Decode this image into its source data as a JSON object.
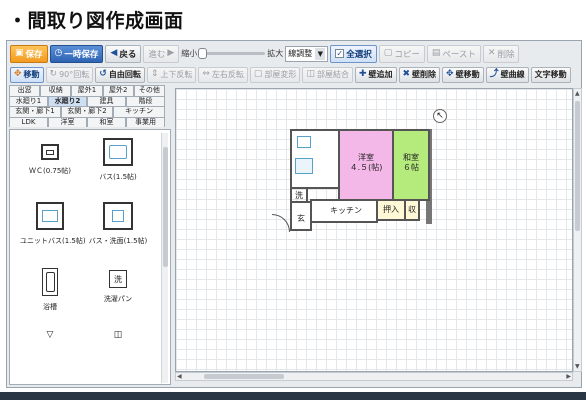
{
  "page": {
    "heading": "・間取り図作成画面"
  },
  "toolbar_main": {
    "save": "保存",
    "temp_save": "一時保存",
    "undo": "戻る",
    "redo": "進む",
    "zoom_small": "縮小",
    "zoom_large": "拡大",
    "wall_adjust": "線調整",
    "select_all": "全選択",
    "copy": "コピー",
    "paste": "ペースト",
    "delete": "削除"
  },
  "toolbar_edit": {
    "move": "移動",
    "rotate90": "90°回転",
    "free_rotate": "自由回転",
    "flip_v": "上下反転",
    "flip_h": "左右反転",
    "room_deform": "部屋変形",
    "room_join": "部屋結合",
    "add_wall": "壁追加",
    "delete_wall": "壁削除",
    "move_wall": "壁移動",
    "curve_wall": "壁曲線",
    "text_move": "文字移動"
  },
  "category_tabs": [
    [
      "出窓",
      "収納",
      "屋外1",
      "屋外2",
      "その他"
    ],
    [
      "水廻り1",
      "水廻り2",
      "建具",
      "階段"
    ],
    [
      "玄関・廊下1",
      "玄関・廊下2",
      "キッチン"
    ],
    [
      "LDK",
      "洋室",
      "和室",
      "事業用"
    ]
  ],
  "active_tab": "水廻り2",
  "palette_items": [
    {
      "label": "ＷＣ(0.75帖)"
    },
    {
      "label": "バス(1.5帖)"
    },
    {
      "label": "ユニットバス(1.5帖)"
    },
    {
      "label": "バス・洗面(1.5帖)"
    },
    {
      "label": "浴槽"
    },
    {
      "label": "洗濯パン",
      "icon_text": "洗"
    }
  ],
  "floor_plan": {
    "rooms": {
      "western": "洋室",
      "western_size": "４.５(帖)",
      "japanese": "和室",
      "japanese_size": "６帖",
      "kitchen": "キッチン",
      "closet": "押入",
      "storage": "収",
      "wash": "洗",
      "entrance": "玄"
    },
    "colors": {
      "western": "#f4b8e8",
      "japanese": "#b5ea7c",
      "closet": "#fff8d6"
    }
  },
  "colors": {
    "save": "#f29a1e",
    "temp_save": "#2e63b3",
    "accent": "#1f4f99"
  }
}
